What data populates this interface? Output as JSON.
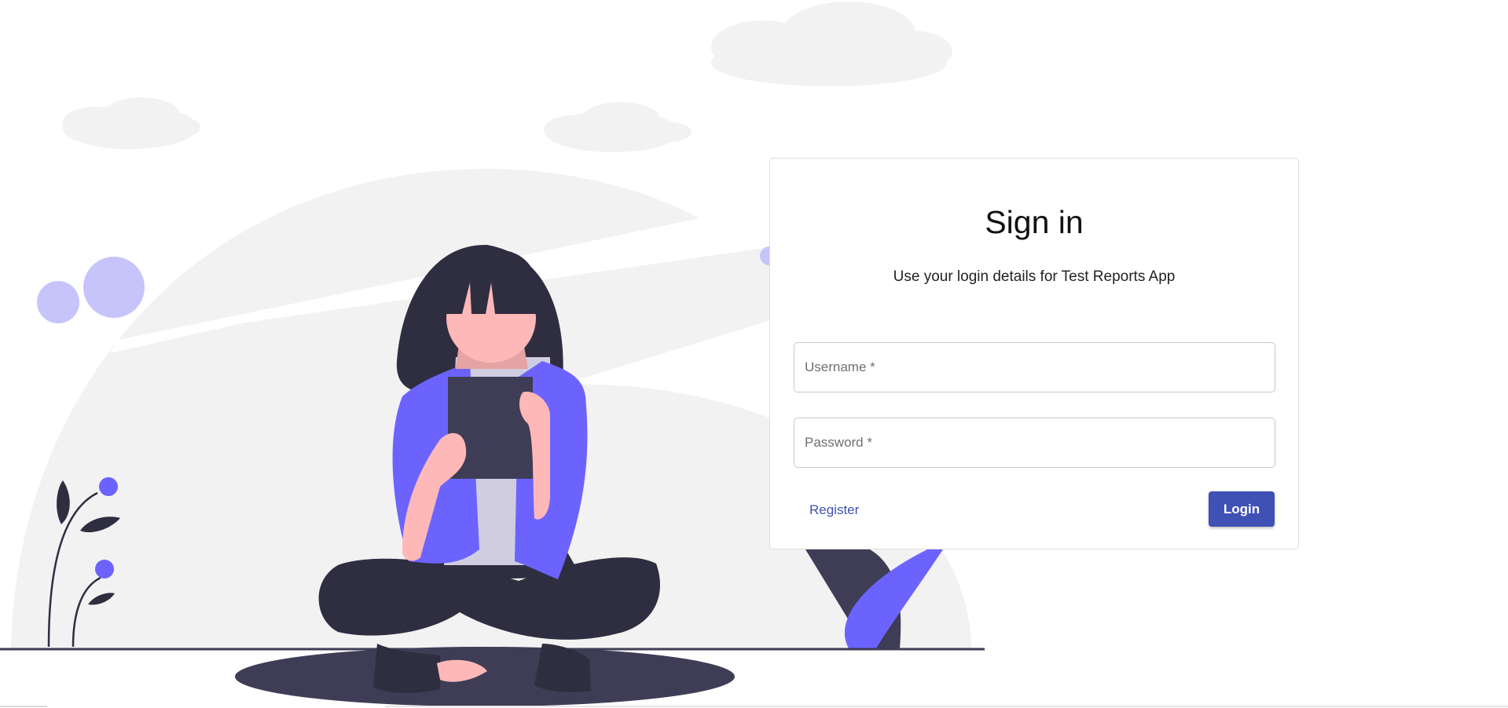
{
  "login": {
    "title": "Sign in",
    "subtitle": "Use your login details for Test Reports App",
    "username_placeholder": "Username *",
    "password_placeholder": "Password *",
    "register_label": "Register",
    "login_label": "Login"
  },
  "colors": {
    "primary": "#3f51b5",
    "illustration_accent": "#6c63ff",
    "illustration_dark": "#2f2e41",
    "illustration_skin": "#ffb8b8",
    "illustration_background": "#f2f2f2"
  }
}
